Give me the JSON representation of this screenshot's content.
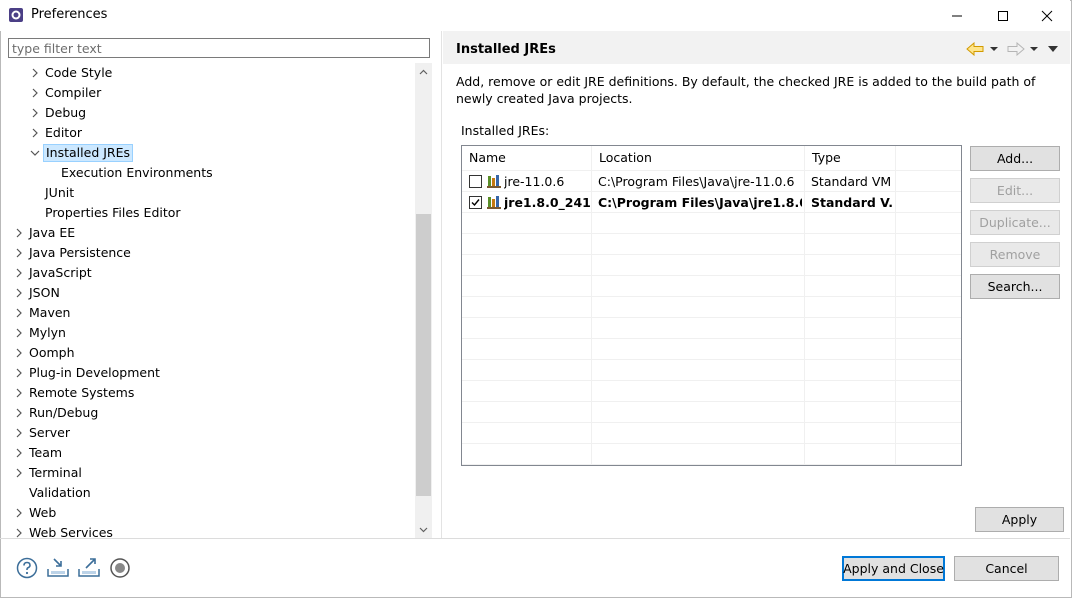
{
  "window": {
    "title": "Preferences"
  },
  "filter": {
    "placeholder": "type filter text"
  },
  "tree": {
    "items": [
      {
        "label": "Code Style",
        "arrow": "right"
      },
      {
        "label": "Compiler",
        "arrow": "right"
      },
      {
        "label": "Debug",
        "arrow": "right"
      },
      {
        "label": "Editor",
        "arrow": "right"
      },
      {
        "label": "Installed JREs",
        "arrow": "down",
        "selected": true
      },
      {
        "label": "Execution Environments",
        "arrow": "none"
      },
      {
        "label": "JUnit",
        "arrow": "none"
      },
      {
        "label": "Properties Files Editor",
        "arrow": "none"
      },
      {
        "label": "Java EE",
        "arrow": "right"
      },
      {
        "label": "Java Persistence",
        "arrow": "right"
      },
      {
        "label": "JavaScript",
        "arrow": "right"
      },
      {
        "label": "JSON",
        "arrow": "right"
      },
      {
        "label": "Maven",
        "arrow": "right"
      },
      {
        "label": "Mylyn",
        "arrow": "right"
      },
      {
        "label": "Oomph",
        "arrow": "right"
      },
      {
        "label": "Plug-in Development",
        "arrow": "right"
      },
      {
        "label": "Remote Systems",
        "arrow": "right"
      },
      {
        "label": "Run/Debug",
        "arrow": "right"
      },
      {
        "label": "Server",
        "arrow": "right"
      },
      {
        "label": "Team",
        "arrow": "right"
      },
      {
        "label": "Terminal",
        "arrow": "right"
      },
      {
        "label": "Validation",
        "arrow": "none"
      },
      {
        "label": "Web",
        "arrow": "right"
      },
      {
        "label": "Web Services",
        "arrow": "right"
      }
    ]
  },
  "page": {
    "title": "Installed JREs",
    "description": "Add, remove or edit JRE definitions. By default, the checked JRE is added to the build path of newly created Java projects.",
    "list_label": "Installed JREs:"
  },
  "table": {
    "headers": [
      "Name",
      "Location",
      "Type"
    ],
    "rows": [
      {
        "checked": false,
        "bold": false,
        "name": "jre-11.0.6",
        "location": "C:\\Program Files\\Java\\jre-11.0.6",
        "type": "Standard VM"
      },
      {
        "checked": true,
        "bold": true,
        "name": "jre1.8.0_241 ...",
        "location": "C:\\Program Files\\Java\\jre1.8.0_...",
        "type": "Standard V..."
      }
    ]
  },
  "buttons": {
    "add": "Add...",
    "edit": "Edit...",
    "duplicate": "Duplicate...",
    "remove": "Remove",
    "search": "Search...",
    "apply": "Apply",
    "apply_close": "Apply and Close",
    "cancel": "Cancel"
  },
  "colors": {
    "selection": "#cce8ff",
    "accent": "#0078d7",
    "nav_arrow": "#f5b400"
  }
}
